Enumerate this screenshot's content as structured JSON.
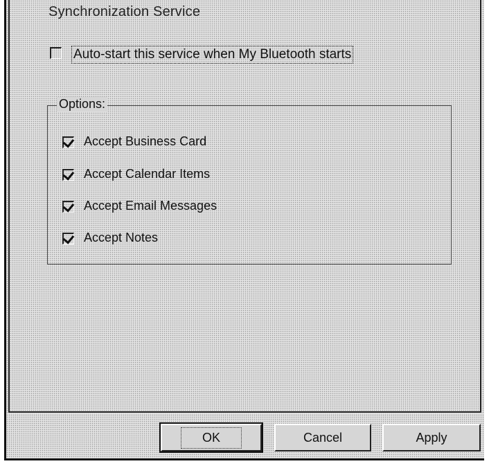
{
  "section_title": "Synchronization Service",
  "autostart": {
    "label": "Auto-start this service when My Bluetooth starts",
    "checked": false
  },
  "options_group": {
    "legend": "Options:",
    "items": [
      {
        "label": "Accept Business Card",
        "checked": true
      },
      {
        "label": "Accept Calendar Items",
        "checked": true
      },
      {
        "label": "Accept Email Messages",
        "checked": true
      },
      {
        "label": "Accept Notes",
        "checked": true
      }
    ]
  },
  "buttons": {
    "ok": "OK",
    "cancel": "Cancel",
    "apply": "Apply"
  }
}
